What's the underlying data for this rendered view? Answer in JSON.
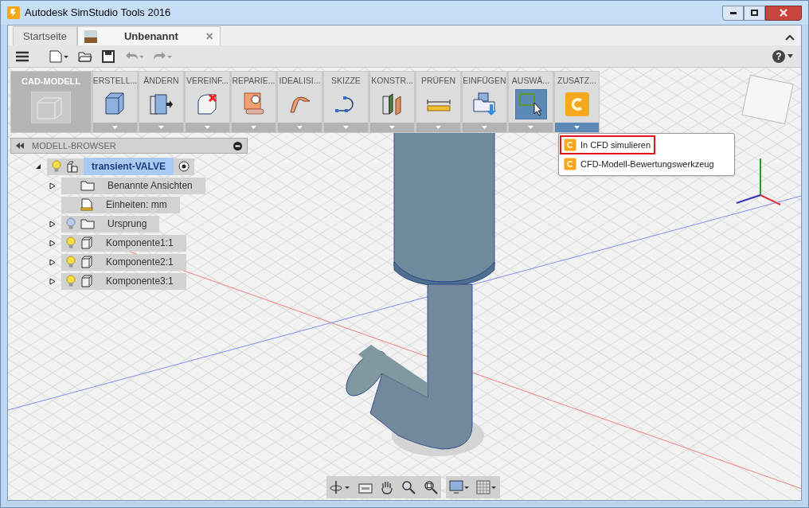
{
  "window": {
    "title": "Autodesk SimStudio Tools 2016"
  },
  "tabs": [
    {
      "label": "Startseite",
      "selected": false
    },
    {
      "label": "Unbenannt",
      "selected": true,
      "close": "×"
    }
  ],
  "help": "?",
  "ribbon": {
    "workspace": "CAD-MODELL",
    "groups": [
      {
        "label": "ERSTELL...",
        "active": false,
        "expanded": false
      },
      {
        "label": "ÄNDERN",
        "active": false,
        "expanded": false
      },
      {
        "label": "VEREINF...",
        "active": false,
        "expanded": false
      },
      {
        "label": "REPARIE...",
        "active": false,
        "expanded": false
      },
      {
        "label": "IDEALISI...",
        "active": false,
        "expanded": false
      },
      {
        "label": "SKIZZE",
        "active": false,
        "expanded": false
      },
      {
        "label": "KONSTR...",
        "active": false,
        "expanded": false
      },
      {
        "label": "PRÜFEN",
        "active": false,
        "expanded": false
      },
      {
        "label": "EINFÜGEN",
        "active": false,
        "expanded": false
      },
      {
        "label": "AUSWÄ...",
        "active": true,
        "expanded": false
      },
      {
        "label": "ZUSATZ...",
        "active": false,
        "expanded": true
      }
    ]
  },
  "dropdown_menu": {
    "items": [
      {
        "label": "In CFD simulieren",
        "highlighted": true
      },
      {
        "label": "CFD-Modell-Bewertungswerkzeug",
        "highlighted": false
      }
    ]
  },
  "browser": {
    "title": "MODELL-BROWSER",
    "tree": [
      {
        "label": "transient-VALVE",
        "kind": "design",
        "selected": true,
        "expanded": true,
        "visible": true,
        "children": [
          {
            "label": "Benannte Ansichten",
            "kind": "views",
            "expanded": false
          },
          {
            "label": "Einheiten: mm",
            "kind": "units"
          },
          {
            "label": "Ursprung",
            "kind": "origin",
            "expanded": false,
            "visible": false
          },
          {
            "label": "Komponente1:1",
            "kind": "component",
            "expanded": false,
            "visible": true
          },
          {
            "label": "Komponente2:1",
            "kind": "component",
            "expanded": false,
            "visible": true
          },
          {
            "label": "Komponente3:1",
            "kind": "component",
            "expanded": false,
            "visible": true
          }
        ]
      }
    ]
  }
}
